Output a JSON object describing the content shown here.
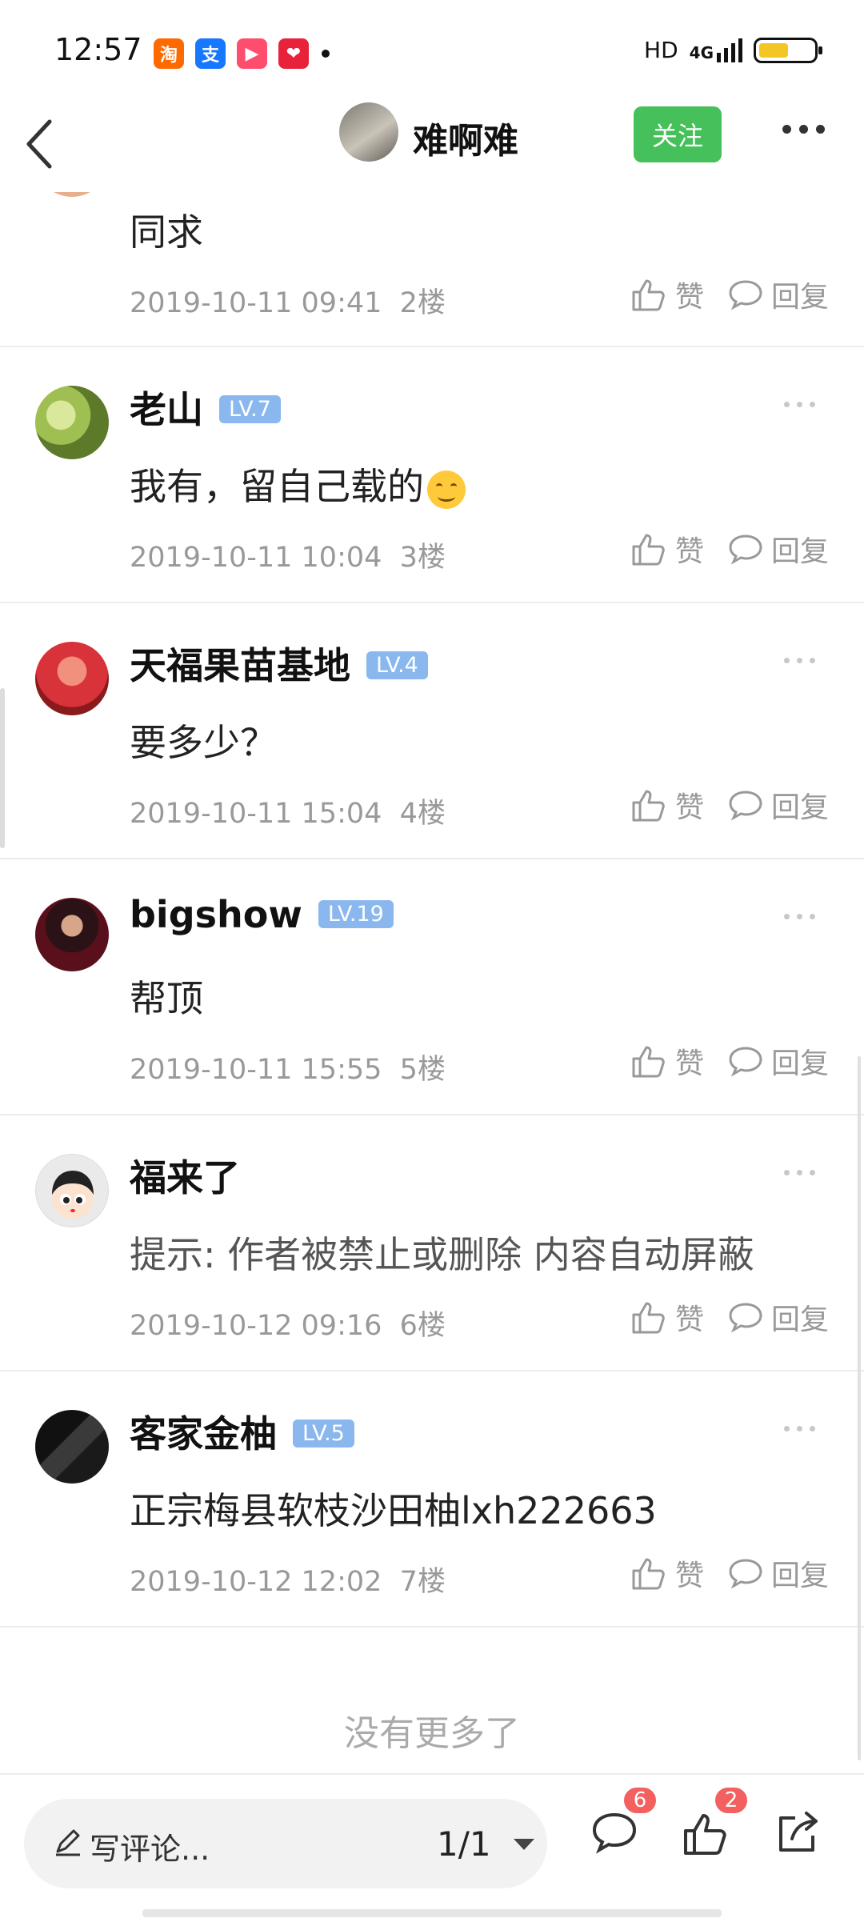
{
  "status": {
    "time": "12:57",
    "notifications": [
      {
        "name": "taobao-icon",
        "glyph": "淘",
        "color": "#ff6a00"
      },
      {
        "name": "alipay-icon",
        "glyph": "支",
        "color": "#1677ff"
      },
      {
        "name": "video-icon",
        "glyph": "▶",
        "color": "#ff4d6d"
      },
      {
        "name": "heart-app-icon",
        "glyph": "❤",
        "color": "#e8223a"
      }
    ],
    "hd": "HD",
    "network": "4G",
    "battery_level": 0.55,
    "battery_color": "#f3c623"
  },
  "header": {
    "title": "难啊难",
    "follow_label": "关注"
  },
  "comments": [
    {
      "name": "",
      "level": "",
      "content": "同求",
      "date": "2019-10-11 09:41",
      "floor": "2楼",
      "like": "赞",
      "reply": "回复",
      "avatar": "partial"
    },
    {
      "name": "老山",
      "level": "LV.7",
      "content": "我有，留自己载的",
      "date": "2019-10-11 10:04",
      "floor": "3楼",
      "like": "赞",
      "reply": "回复",
      "avatar": "pomelo-green"
    },
    {
      "name": "天福果苗基地",
      "level": "LV.4",
      "content": "要多少？",
      "date": "2019-10-11 15:04",
      "floor": "4楼",
      "like": "赞",
      "reply": "回复",
      "avatar": "pomelo-red"
    },
    {
      "name": "bigshow",
      "level": "LV.19",
      "content": "帮顶",
      "date": "2019-10-11 15:55",
      "floor": "5楼",
      "like": "赞",
      "reply": "回复",
      "avatar": "person-dark"
    },
    {
      "name": "福来了",
      "level": "",
      "content": "提示: 作者被禁止或删除 内容自动屏蔽",
      "date": "2019-10-12 09:16",
      "floor": "6楼",
      "like": "赞",
      "reply": "回复",
      "avatar": "cartoon-default"
    },
    {
      "name": "客家金柚",
      "level": "LV.5",
      "content": "正宗梅县软枝沙田柚lxh222663",
      "date": "2019-10-12 12:02",
      "floor": "7楼",
      "like": "赞",
      "reply": "回复",
      "avatar": "device-dark"
    }
  ],
  "end_text": "没有更多了",
  "bottom": {
    "write_placeholder": "写评论...",
    "page": "1/1",
    "comment_count": "6",
    "like_count": "2"
  }
}
